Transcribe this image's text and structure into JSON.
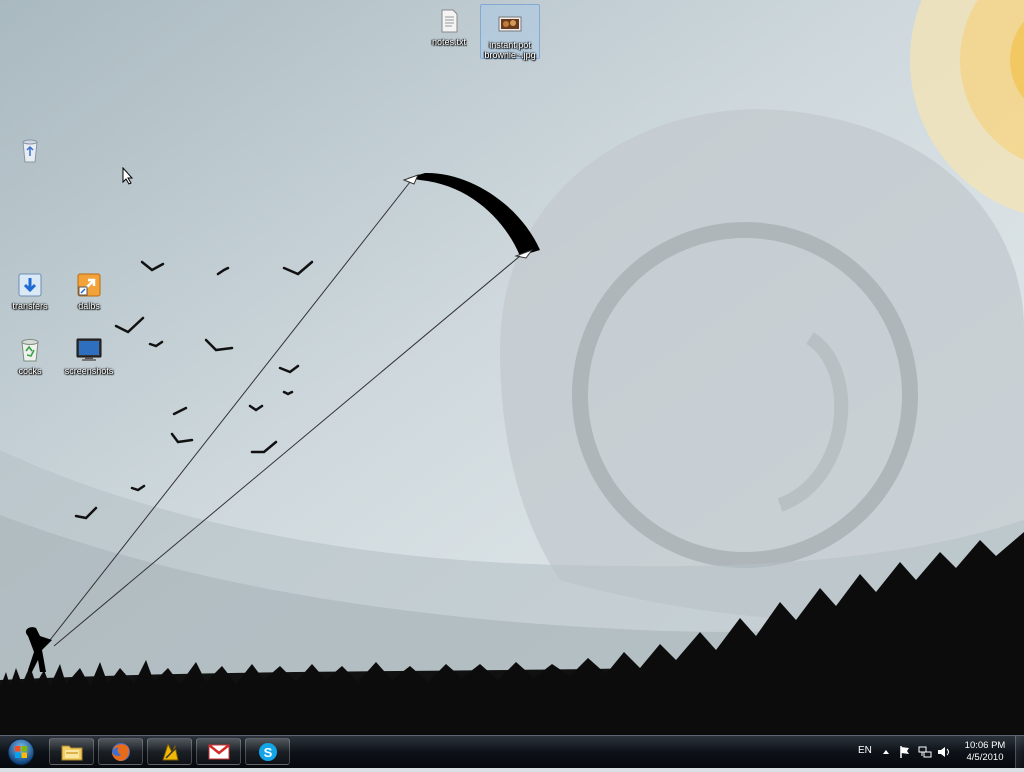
{
  "desktop": {
    "icons": [
      {
        "id": "notes",
        "label": "notes.txt",
        "icon": "text-file-icon",
        "selected": false
      },
      {
        "id": "instant-pot",
        "label": "instant pot brownie~.jpg",
        "icon": "image-file-icon",
        "selected": true
      },
      {
        "id": "recycle-bin",
        "label": "",
        "icon": "recycle-bin-icon",
        "selected": false
      },
      {
        "id": "transfers",
        "label": "transfers",
        "icon": "download-folder-icon",
        "selected": false
      },
      {
        "id": "dalbs",
        "label": "dalbs",
        "icon": "shortcut-icon",
        "selected": false
      },
      {
        "id": "cocks",
        "label": "cocks",
        "icon": "recycle-bin-full-icon",
        "selected": false
      },
      {
        "id": "screenshots",
        "label": "screenshots",
        "icon": "monitor-icon",
        "selected": false
      }
    ]
  },
  "taskbar": {
    "pinned": [
      {
        "name": "Windows Explorer",
        "icon": "folder-library-icon"
      },
      {
        "name": "Firefox",
        "icon": "firefox-icon"
      },
      {
        "name": "Winamp",
        "icon": "winamp-icon"
      },
      {
        "name": "Gmail",
        "icon": "gmail-icon"
      },
      {
        "name": "Skype",
        "icon": "skype-icon"
      }
    ],
    "tray": {
      "language": "EN",
      "time": "10:06 PM",
      "date": "4/5/2010"
    }
  }
}
